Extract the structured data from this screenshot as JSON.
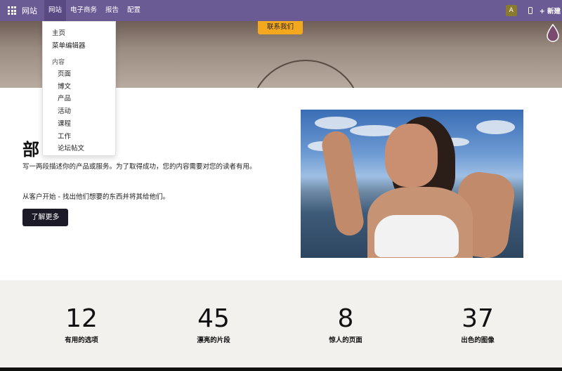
{
  "navbar": {
    "brand": "网站",
    "items": [
      "网站",
      "电子商务",
      "报告",
      "配置"
    ],
    "avatar": "A",
    "new_label": "+ 新建",
    "color": "#6b5b95"
  },
  "hero": {
    "contact_button": "联系我们",
    "accent_color": "#f4a81d"
  },
  "dropdown": {
    "home": "主页",
    "menu_editor": "菜单编辑器",
    "content_header": "内容",
    "content_items": [
      "页面",
      "博文",
      "产品",
      "活动",
      "课程",
      "工作",
      "论坛帖文"
    ]
  },
  "content": {
    "heading": "部",
    "paragraph1": "写一两段描述你的产品或服务。为了取得成功，您的内容需要对您的读者有用。",
    "paragraph2": "从客户开始 - 找出他们想要的东西并将其给他们。",
    "learn_more": "了解更多"
  },
  "stats": [
    {
      "number": "12",
      "label": "有用的选项"
    },
    {
      "number": "45",
      "label": "漂亮的片段"
    },
    {
      "number": "8",
      "label": "惊人的页面"
    },
    {
      "number": "37",
      "label": "出色的图像"
    }
  ]
}
